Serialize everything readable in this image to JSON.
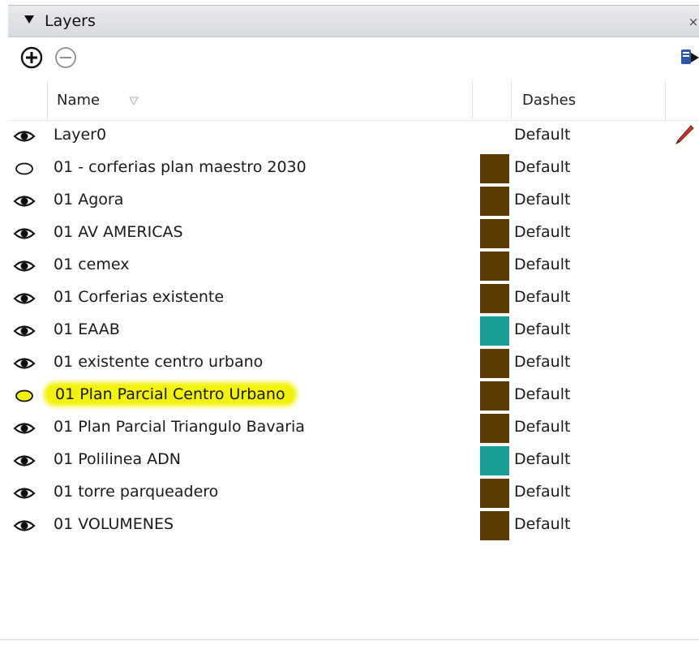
{
  "panel": {
    "title": "Layers",
    "collapse_icon": "triangle-down-icon",
    "close_label": "×"
  },
  "toolbar": {
    "add_icon": "plus-circle-icon",
    "remove_icon": "minus-circle-icon",
    "details_icon": "details-arrow-icon"
  },
  "table": {
    "columns": {
      "name": "Name",
      "dashes": "Dashes"
    },
    "rows": [
      {
        "name": "Layer0",
        "visible": true,
        "color": null,
        "dashes": "Default",
        "active": true
      },
      {
        "name": "01 - corferias plan maestro 2030",
        "visible": false,
        "color": "#5c3b04",
        "dashes": "Default"
      },
      {
        "name": "01 Agora",
        "visible": true,
        "color": "#5c3b04",
        "dashes": "Default"
      },
      {
        "name": "01 AV AMERICAS",
        "visible": true,
        "color": "#5c3b04",
        "dashes": "Default"
      },
      {
        "name": "01 cemex",
        "visible": true,
        "color": "#5c3b04",
        "dashes": "Default"
      },
      {
        "name": "01 Corferias existente",
        "visible": true,
        "color": "#5c3b04",
        "dashes": "Default"
      },
      {
        "name": "01 EAAB",
        "visible": true,
        "color": "#1a9f96",
        "dashes": "Default"
      },
      {
        "name": "01 existente centro urbano",
        "visible": true,
        "color": "#5c3b04",
        "dashes": "Default"
      },
      {
        "name": "01 Plan Parcial Centro Urbano",
        "visible": false,
        "color": "#5c3b04",
        "dashes": "Default",
        "highlight": "#f2f20f"
      },
      {
        "name": "01 Plan Parcial Triangulo Bavaria",
        "visible": true,
        "color": "#5c3b04",
        "dashes": "Default"
      },
      {
        "name": "01 Polilinea ADN",
        "visible": true,
        "color": "#1a9f96",
        "dashes": "Default"
      },
      {
        "name": "01 torre parqueadero",
        "visible": true,
        "color": "#5c3b04",
        "dashes": "Default"
      },
      {
        "name": "01 VOLUMENES",
        "visible": true,
        "color": "#5c3b04",
        "dashes": "Default"
      }
    ]
  }
}
